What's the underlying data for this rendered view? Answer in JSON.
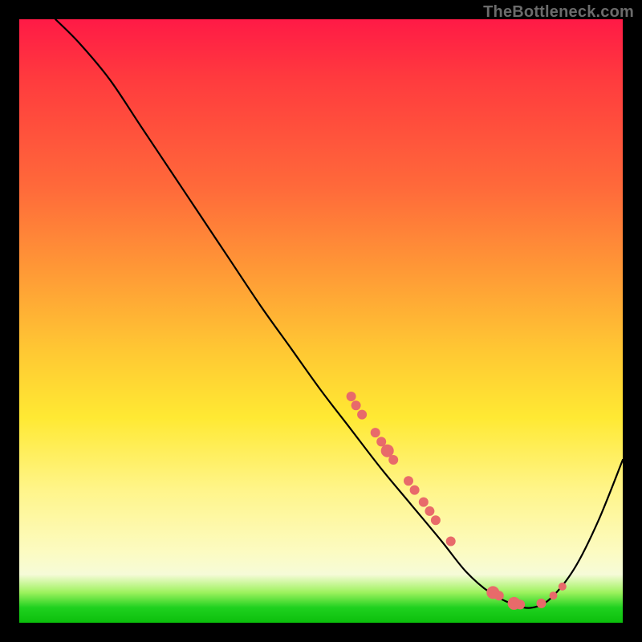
{
  "watermark": "TheBottleneck.com",
  "colors": {
    "background": "#000000",
    "curve": "#000000",
    "marker": "#e86a6a"
  },
  "chart_data": {
    "type": "line",
    "title": "",
    "xlabel": "",
    "ylabel": "",
    "xlim": [
      0,
      100
    ],
    "ylim": [
      0,
      100
    ],
    "grid": false,
    "legend": false,
    "note": "Axis tick labels are not rendered in the image; values below are estimated from relative pixel position (0–100 normalized).",
    "series": [
      {
        "name": "bottleneck-curve",
        "x": [
          6,
          10,
          15,
          20,
          25,
          30,
          35,
          40,
          45,
          50,
          55,
          60,
          65,
          70,
          74,
          78,
          82,
          85,
          88,
          92,
          96,
          100
        ],
        "y": [
          100,
          96,
          90,
          82.5,
          75,
          67.5,
          60,
          52.5,
          45.5,
          38.5,
          32,
          25.5,
          19.5,
          13.5,
          8.5,
          5,
          3,
          2.5,
          4,
          9,
          17,
          27
        ]
      }
    ],
    "markers": {
      "name": "highlighted-points",
      "color": "#e86a6a",
      "points": [
        {
          "x": 55.0,
          "y": 37.5,
          "r": 6
        },
        {
          "x": 55.8,
          "y": 36.0,
          "r": 6
        },
        {
          "x": 56.8,
          "y": 34.5,
          "r": 6
        },
        {
          "x": 59.0,
          "y": 31.5,
          "r": 6
        },
        {
          "x": 60.0,
          "y": 30.0,
          "r": 6
        },
        {
          "x": 61.0,
          "y": 28.5,
          "r": 8
        },
        {
          "x": 62.0,
          "y": 27.0,
          "r": 6
        },
        {
          "x": 64.5,
          "y": 23.5,
          "r": 6
        },
        {
          "x": 65.5,
          "y": 22.0,
          "r": 6
        },
        {
          "x": 67.0,
          "y": 20.0,
          "r": 6
        },
        {
          "x": 68.0,
          "y": 18.5,
          "r": 6
        },
        {
          "x": 69.0,
          "y": 17.0,
          "r": 6
        },
        {
          "x": 71.5,
          "y": 13.5,
          "r": 6
        },
        {
          "x": 78.5,
          "y": 5.0,
          "r": 8
        },
        {
          "x": 79.5,
          "y": 4.5,
          "r": 6
        },
        {
          "x": 82.0,
          "y": 3.2,
          "r": 8
        },
        {
          "x": 83.0,
          "y": 3.0,
          "r": 6
        },
        {
          "x": 86.5,
          "y": 3.2,
          "r": 6
        },
        {
          "x": 88.5,
          "y": 4.5,
          "r": 5
        },
        {
          "x": 90.0,
          "y": 6.0,
          "r": 5
        }
      ]
    }
  }
}
